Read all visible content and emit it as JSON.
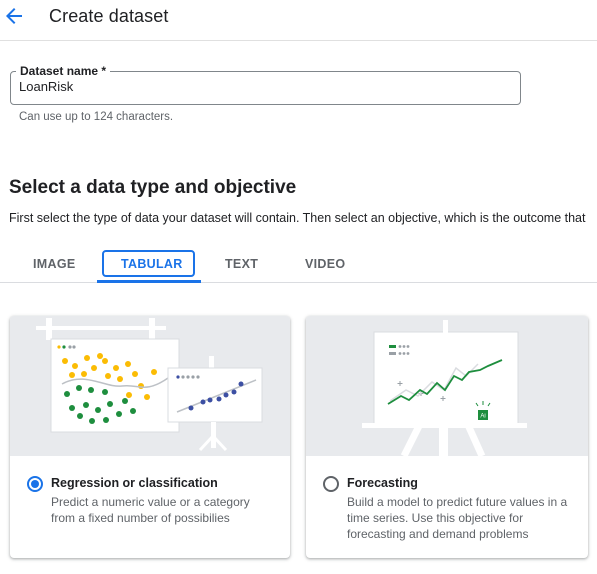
{
  "header": {
    "title": "Create dataset",
    "back_icon": "arrow-left-icon"
  },
  "dataset_name": {
    "label": "Dataset name *",
    "value": "LoanRisk",
    "hint": "Can use up to 124 characters."
  },
  "section": {
    "title": "Select a data type and objective",
    "description": "First select the type of data your dataset will contain. Then select an objective, which is the outcome that"
  },
  "tabs": [
    {
      "label": "IMAGE",
      "active": false
    },
    {
      "label": "TABULAR",
      "active": true
    },
    {
      "label": "TEXT",
      "active": false
    },
    {
      "label": "VIDEO",
      "active": false
    }
  ],
  "objectives": [
    {
      "title": "Regression or classification",
      "description": [
        "Predict a numeric value or a category",
        "from a fixed number of possibilies"
      ],
      "selected": true
    },
    {
      "title": "Forecasting",
      "description": [
        "Build a model to predict future values in a",
        "time series. Use this objective for",
        "forecasting and demand problems"
      ],
      "selected": false,
      "badge": "Ai"
    }
  ],
  "colors": {
    "accent": "#1a73e8",
    "green": "#1e8e3e",
    "yellow": "#fbbc04",
    "navy": "#3c4fa3",
    "illustration_bg": "#e8eaed"
  }
}
